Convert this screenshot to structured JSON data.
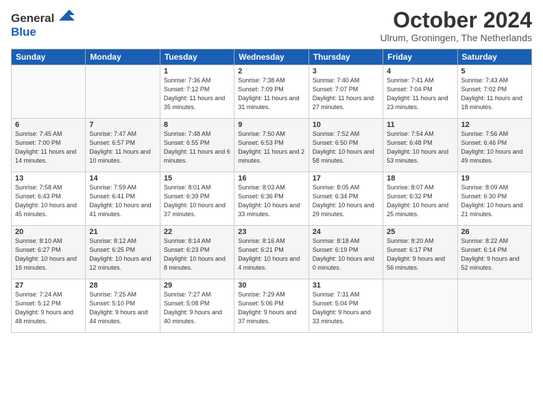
{
  "logo": {
    "line1": "General",
    "line2": "Blue"
  },
  "header": {
    "title": "October 2024",
    "location": "Ulrum, Groningen, The Netherlands"
  },
  "weekdays": [
    "Sunday",
    "Monday",
    "Tuesday",
    "Wednesday",
    "Thursday",
    "Friday",
    "Saturday"
  ],
  "weeks": [
    [
      {
        "day": "",
        "sunrise": "",
        "sunset": "",
        "daylight": ""
      },
      {
        "day": "",
        "sunrise": "",
        "sunset": "",
        "daylight": ""
      },
      {
        "day": "1",
        "sunrise": "Sunrise: 7:36 AM",
        "sunset": "Sunset: 7:12 PM",
        "daylight": "Daylight: 11 hours and 35 minutes."
      },
      {
        "day": "2",
        "sunrise": "Sunrise: 7:38 AM",
        "sunset": "Sunset: 7:09 PM",
        "daylight": "Daylight: 11 hours and 31 minutes."
      },
      {
        "day": "3",
        "sunrise": "Sunrise: 7:40 AM",
        "sunset": "Sunset: 7:07 PM",
        "daylight": "Daylight: 11 hours and 27 minutes."
      },
      {
        "day": "4",
        "sunrise": "Sunrise: 7:41 AM",
        "sunset": "Sunset: 7:04 PM",
        "daylight": "Daylight: 11 hours and 23 minutes."
      },
      {
        "day": "5",
        "sunrise": "Sunrise: 7:43 AM",
        "sunset": "Sunset: 7:02 PM",
        "daylight": "Daylight: 11 hours and 18 minutes."
      }
    ],
    [
      {
        "day": "6",
        "sunrise": "Sunrise: 7:45 AM",
        "sunset": "Sunset: 7:00 PM",
        "daylight": "Daylight: 11 hours and 14 minutes."
      },
      {
        "day": "7",
        "sunrise": "Sunrise: 7:47 AM",
        "sunset": "Sunset: 6:57 PM",
        "daylight": "Daylight: 11 hours and 10 minutes."
      },
      {
        "day": "8",
        "sunrise": "Sunrise: 7:48 AM",
        "sunset": "Sunset: 6:55 PM",
        "daylight": "Daylight: 11 hours and 6 minutes."
      },
      {
        "day": "9",
        "sunrise": "Sunrise: 7:50 AM",
        "sunset": "Sunset: 6:53 PM",
        "daylight": "Daylight: 11 hours and 2 minutes."
      },
      {
        "day": "10",
        "sunrise": "Sunrise: 7:52 AM",
        "sunset": "Sunset: 6:50 PM",
        "daylight": "Daylight: 10 hours and 58 minutes."
      },
      {
        "day": "11",
        "sunrise": "Sunrise: 7:54 AM",
        "sunset": "Sunset: 6:48 PM",
        "daylight": "Daylight: 10 hours and 53 minutes."
      },
      {
        "day": "12",
        "sunrise": "Sunrise: 7:56 AM",
        "sunset": "Sunset: 6:46 PM",
        "daylight": "Daylight: 10 hours and 49 minutes."
      }
    ],
    [
      {
        "day": "13",
        "sunrise": "Sunrise: 7:58 AM",
        "sunset": "Sunset: 6:43 PM",
        "daylight": "Daylight: 10 hours and 45 minutes."
      },
      {
        "day": "14",
        "sunrise": "Sunrise: 7:59 AM",
        "sunset": "Sunset: 6:41 PM",
        "daylight": "Daylight: 10 hours and 41 minutes."
      },
      {
        "day": "15",
        "sunrise": "Sunrise: 8:01 AM",
        "sunset": "Sunset: 6:39 PM",
        "daylight": "Daylight: 10 hours and 37 minutes."
      },
      {
        "day": "16",
        "sunrise": "Sunrise: 8:03 AM",
        "sunset": "Sunset: 6:36 PM",
        "daylight": "Daylight: 10 hours and 33 minutes."
      },
      {
        "day": "17",
        "sunrise": "Sunrise: 8:05 AM",
        "sunset": "Sunset: 6:34 PM",
        "daylight": "Daylight: 10 hours and 29 minutes."
      },
      {
        "day": "18",
        "sunrise": "Sunrise: 8:07 AM",
        "sunset": "Sunset: 6:32 PM",
        "daylight": "Daylight: 10 hours and 25 minutes."
      },
      {
        "day": "19",
        "sunrise": "Sunrise: 8:09 AM",
        "sunset": "Sunset: 6:30 PM",
        "daylight": "Daylight: 10 hours and 21 minutes."
      }
    ],
    [
      {
        "day": "20",
        "sunrise": "Sunrise: 8:10 AM",
        "sunset": "Sunset: 6:27 PM",
        "daylight": "Daylight: 10 hours and 16 minutes."
      },
      {
        "day": "21",
        "sunrise": "Sunrise: 8:12 AM",
        "sunset": "Sunset: 6:25 PM",
        "daylight": "Daylight: 10 hours and 12 minutes."
      },
      {
        "day": "22",
        "sunrise": "Sunrise: 8:14 AM",
        "sunset": "Sunset: 6:23 PM",
        "daylight": "Daylight: 10 hours and 8 minutes."
      },
      {
        "day": "23",
        "sunrise": "Sunrise: 8:16 AM",
        "sunset": "Sunset: 6:21 PM",
        "daylight": "Daylight: 10 hours and 4 minutes."
      },
      {
        "day": "24",
        "sunrise": "Sunrise: 8:18 AM",
        "sunset": "Sunset: 6:19 PM",
        "daylight": "Daylight: 10 hours and 0 minutes."
      },
      {
        "day": "25",
        "sunrise": "Sunrise: 8:20 AM",
        "sunset": "Sunset: 6:17 PM",
        "daylight": "Daylight: 9 hours and 56 minutes."
      },
      {
        "day": "26",
        "sunrise": "Sunrise: 8:22 AM",
        "sunset": "Sunset: 6:14 PM",
        "daylight": "Daylight: 9 hours and 52 minutes."
      }
    ],
    [
      {
        "day": "27",
        "sunrise": "Sunrise: 7:24 AM",
        "sunset": "Sunset: 5:12 PM",
        "daylight": "Daylight: 9 hours and 48 minutes."
      },
      {
        "day": "28",
        "sunrise": "Sunrise: 7:25 AM",
        "sunset": "Sunset: 5:10 PM",
        "daylight": "Daylight: 9 hours and 44 minutes."
      },
      {
        "day": "29",
        "sunrise": "Sunrise: 7:27 AM",
        "sunset": "Sunset: 5:08 PM",
        "daylight": "Daylight: 9 hours and 40 minutes."
      },
      {
        "day": "30",
        "sunrise": "Sunrise: 7:29 AM",
        "sunset": "Sunset: 5:06 PM",
        "daylight": "Daylight: 9 hours and 37 minutes."
      },
      {
        "day": "31",
        "sunrise": "Sunrise: 7:31 AM",
        "sunset": "Sunset: 5:04 PM",
        "daylight": "Daylight: 9 hours and 33 minutes."
      },
      {
        "day": "",
        "sunrise": "",
        "sunset": "",
        "daylight": ""
      },
      {
        "day": "",
        "sunrise": "",
        "sunset": "",
        "daylight": ""
      }
    ]
  ]
}
